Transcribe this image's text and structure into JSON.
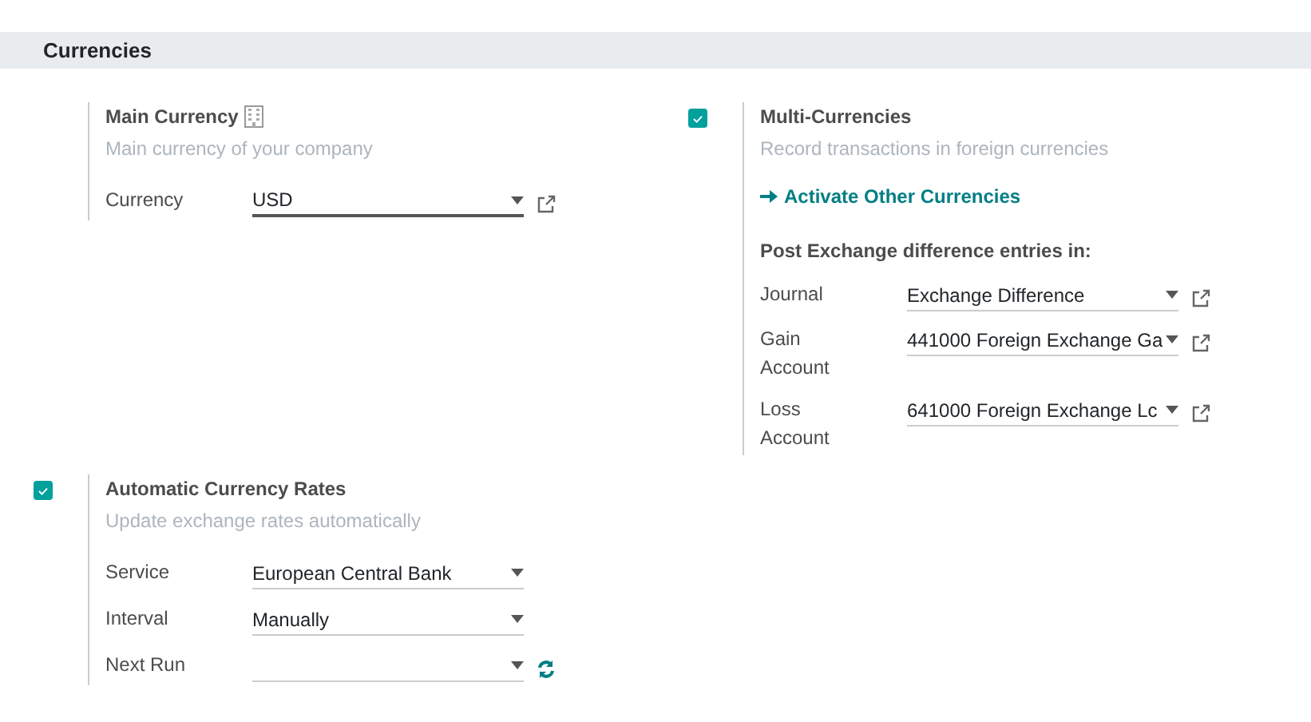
{
  "section": {
    "title": "Currencies"
  },
  "settings": [
    {
      "title": "Main Currency",
      "company_icon": true,
      "description": "Main currency of your company",
      "fields": [
        {
          "label": "Currency",
          "value": "USD",
          "focused": true,
          "external": true
        }
      ]
    },
    {
      "checkbox": {
        "checked": true
      },
      "title": "Multi-Currencies",
      "description": "Record transactions in foreign currencies",
      "link": "Activate Other Currencies",
      "subheading": "Post Exchange difference entries in:",
      "fields": [
        {
          "label": "Journal",
          "value": "Exchange Difference",
          "focused": false,
          "external": true
        },
        {
          "label": "Gain Account",
          "value": "441000 Foreign Exchange Ga",
          "focused": false,
          "external": true
        },
        {
          "label": "Loss Account",
          "value": "641000 Foreign Exchange Lc",
          "focused": false,
          "external": true
        }
      ]
    },
    {
      "checkbox": {
        "checked": true
      },
      "title": "Automatic Currency Rates",
      "description": "Update exchange rates automatically",
      "fields": [
        {
          "label": "Service",
          "value": "European Central Bank",
          "focused": false
        },
        {
          "label": "Interval",
          "value": "Manually",
          "focused": false
        },
        {
          "label": "Next Run",
          "focused": false,
          "refresh": true
        }
      ]
    }
  ]
}
